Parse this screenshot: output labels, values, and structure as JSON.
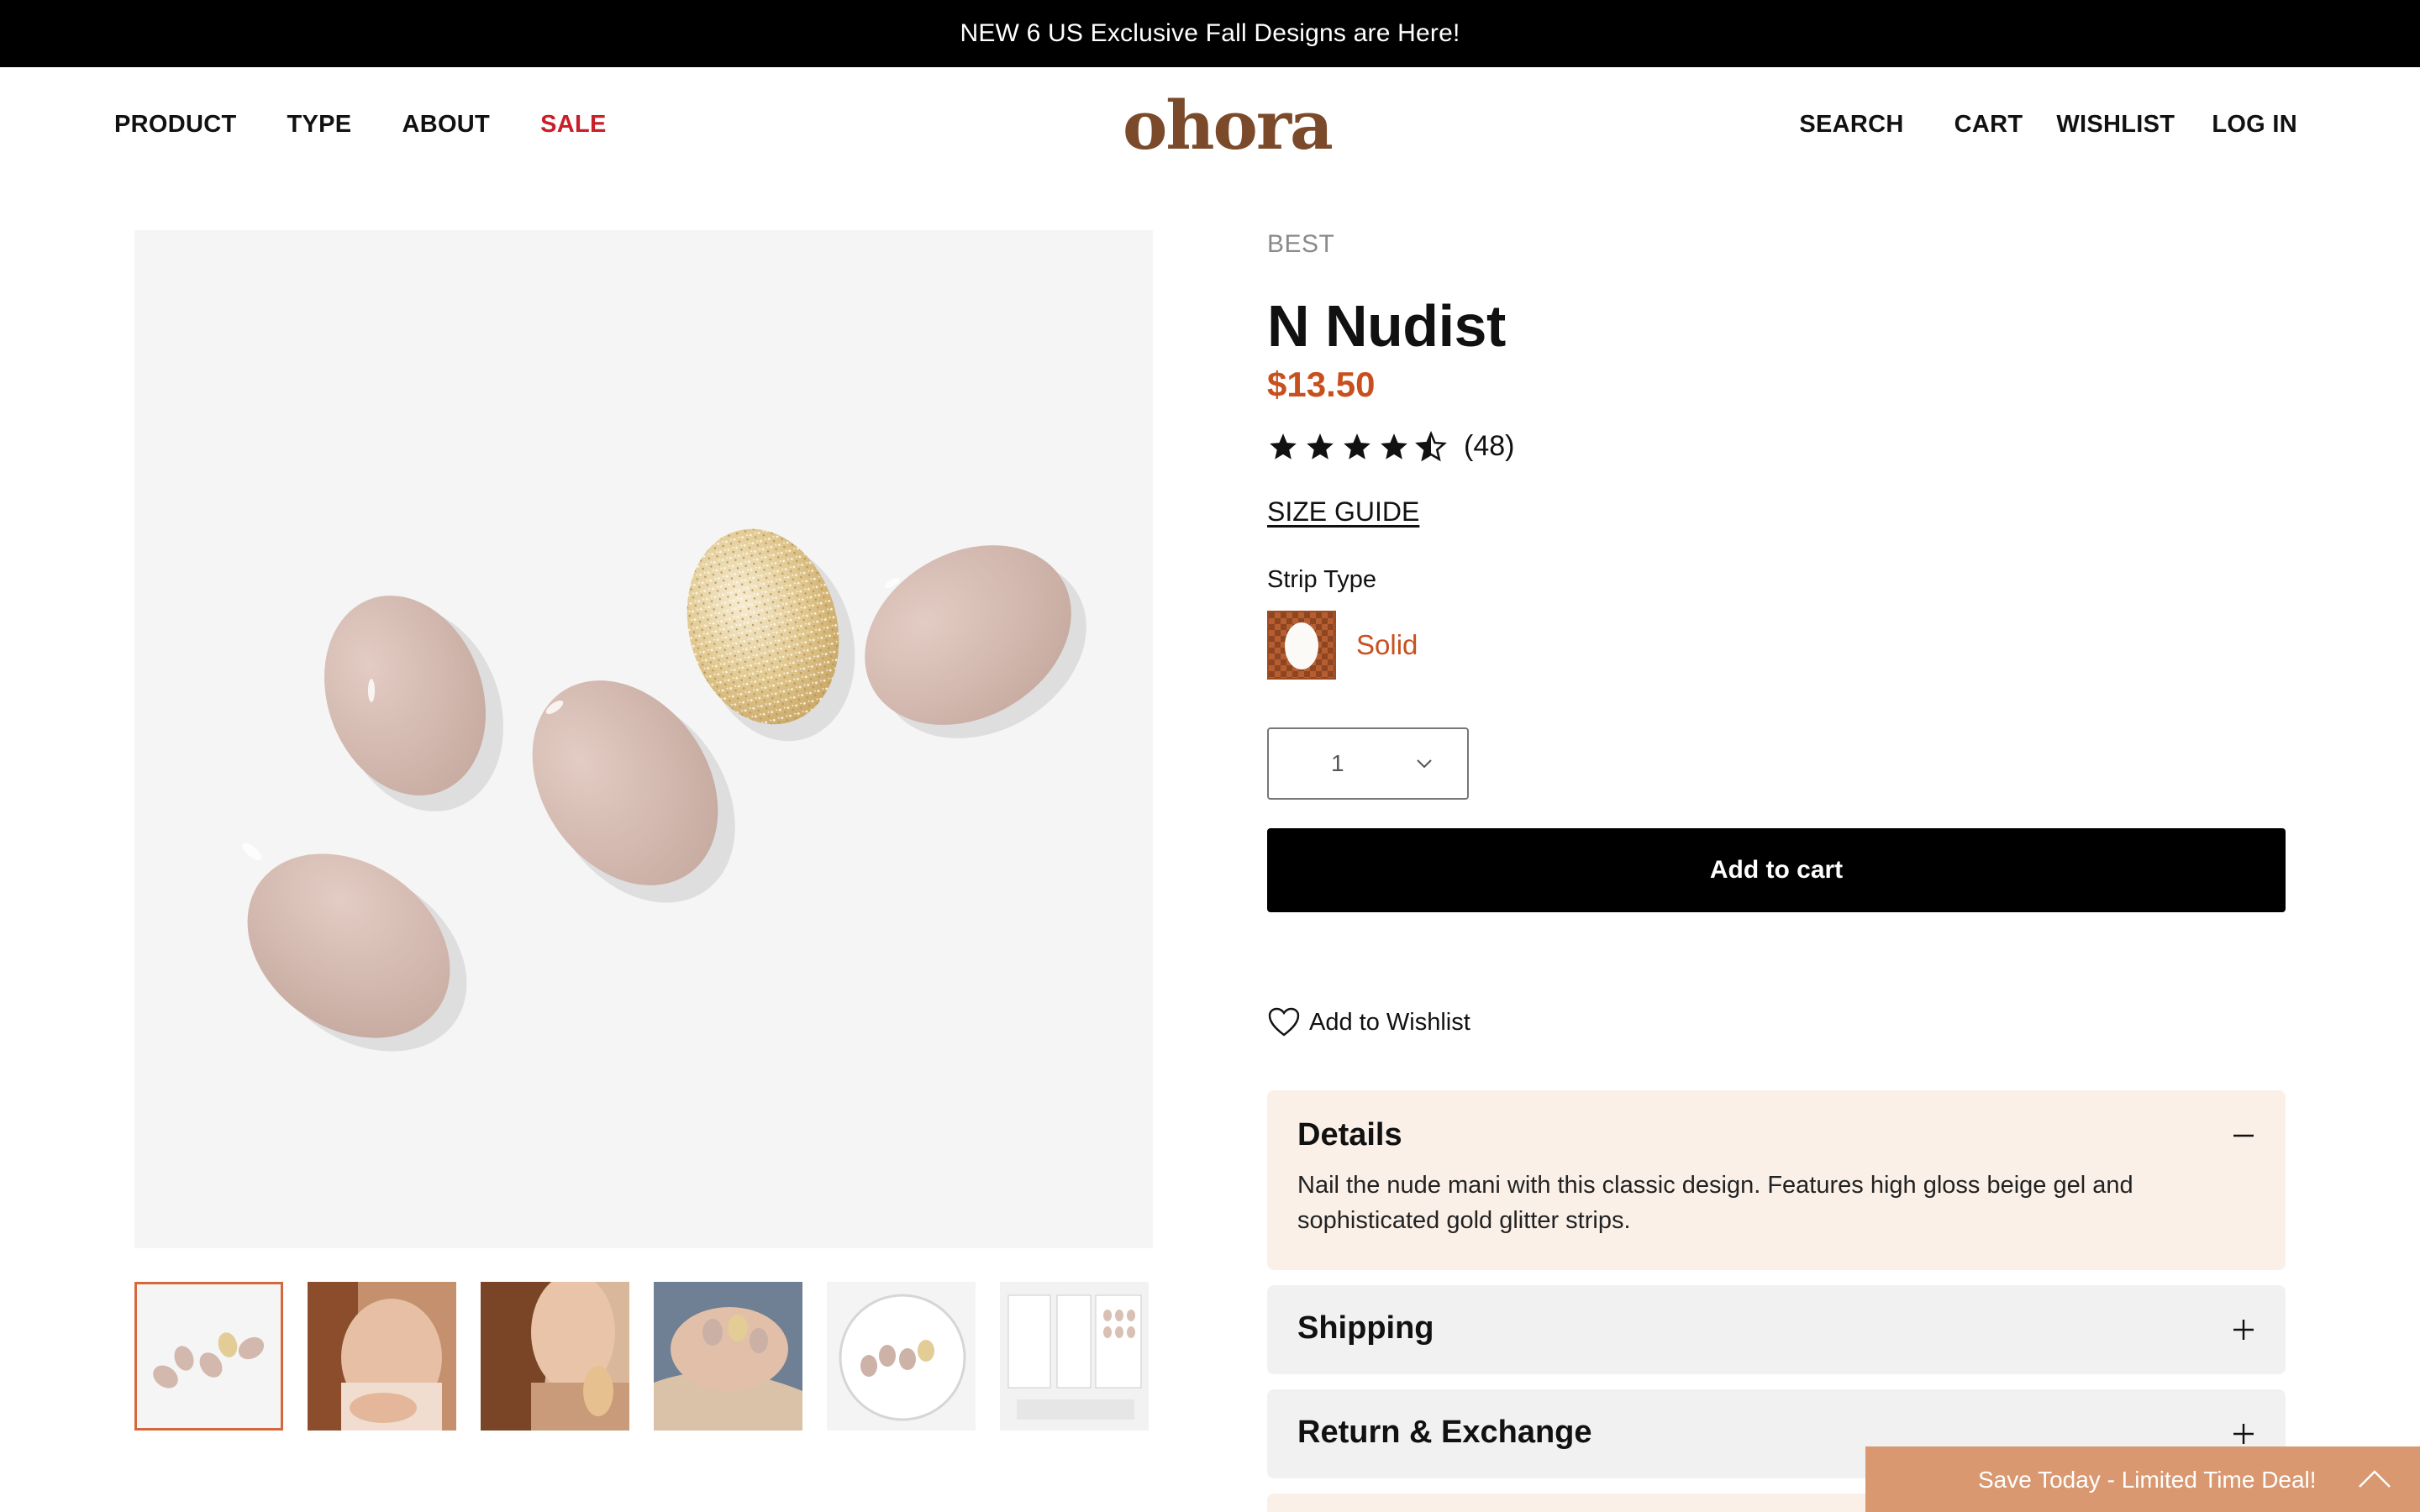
{
  "announcement": "NEW 6 US Exclusive Fall Designs are Here!",
  "nav": {
    "left": [
      "PRODUCT",
      "TYPE",
      "ABOUT",
      "SALE"
    ],
    "logo": "ohora",
    "right": [
      "SEARCH",
      "CART",
      "WISHLIST",
      "LOG IN"
    ]
  },
  "product": {
    "tag": "BEST",
    "title": "N Nudist",
    "price": "$13.50",
    "rating": 4.5,
    "review_count": "(48)",
    "size_guide": "SIZE GUIDE",
    "strip_type_label": "Strip Type",
    "strip_type_value": "Solid",
    "quantity": "1",
    "add_to_cart": "Add to cart",
    "add_to_wishlist": "Add to Wishlist"
  },
  "accordion": {
    "details_title": "Details",
    "details_body": "Nail the nude mani with this classic design. Features high gloss beige gel and sophisticated gold glitter strips.",
    "shipping_title": "Shipping",
    "return_title": "Return & Exchange"
  },
  "promo": "Save Today - Limited Time Deal!",
  "colors": {
    "accent_price": "#c8501e",
    "sale": "#c8202a",
    "logo": "#7b4a2a",
    "details_bg": "#faf0e8",
    "promo_bg": "#d99870"
  },
  "thumbnails": [
    "thumb-nails-flatlay",
    "thumb-hands-model",
    "thumb-model-hair",
    "thumb-nails-closeup",
    "thumb-packaging-circle",
    "thumb-instructions"
  ]
}
